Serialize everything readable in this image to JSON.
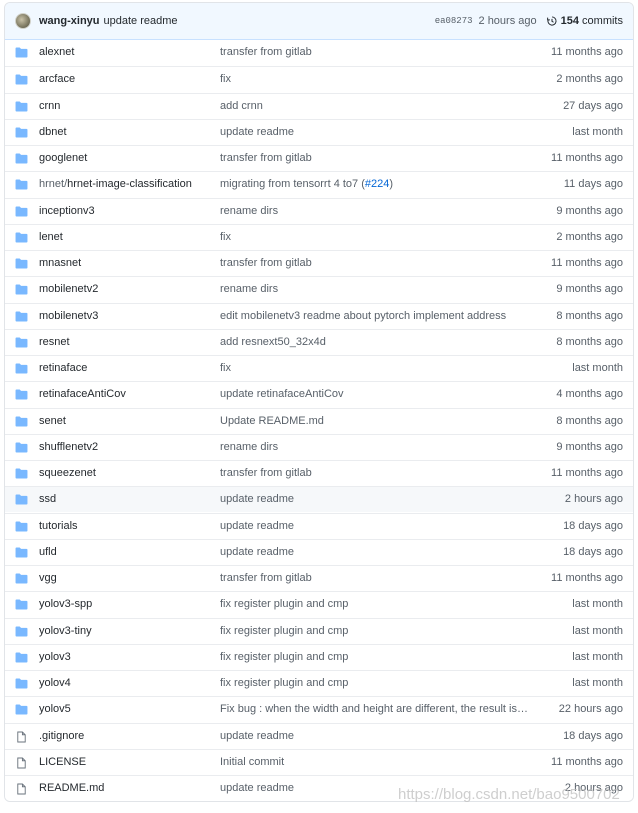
{
  "colors": {
    "folder": "#79b8ff",
    "link": "#0366d6",
    "header_bg": "#f1f8ff",
    "muted": "#586069"
  },
  "header": {
    "author": "wang-xinyu",
    "message": "update readme",
    "sha": "ea08273",
    "time": "2 hours ago",
    "commit_count": "154",
    "commits_label": "commits",
    "history_icon": "history-icon"
  },
  "files": [
    {
      "icon": "folder",
      "name": "alexnet",
      "message": "transfer from gitlab",
      "age": "11 months ago"
    },
    {
      "icon": "folder",
      "name": "arcface",
      "message": "fix",
      "age": "2 months ago"
    },
    {
      "icon": "folder",
      "name": "crnn",
      "message": "add crnn",
      "age": "27 days ago"
    },
    {
      "icon": "folder",
      "name": "dbnet",
      "message": "update readme",
      "age": "last month"
    },
    {
      "icon": "folder",
      "name": "googlenet",
      "message": "transfer from gitlab",
      "age": "11 months ago"
    },
    {
      "icon": "folder",
      "name_prefix": "hrnet/",
      "name": "hrnet-image-classification",
      "message": "migrating from tensorrt 4 to7 (",
      "message_link": "#224",
      "message_suffix": ")",
      "age": "11 days ago"
    },
    {
      "icon": "folder",
      "name": "inceptionv3",
      "message": "rename dirs",
      "age": "9 months ago"
    },
    {
      "icon": "folder",
      "name": "lenet",
      "message": "fix",
      "age": "2 months ago"
    },
    {
      "icon": "folder",
      "name": "mnasnet",
      "message": "transfer from gitlab",
      "age": "11 months ago"
    },
    {
      "icon": "folder",
      "name": "mobilenetv2",
      "message": "rename dirs",
      "age": "9 months ago"
    },
    {
      "icon": "folder",
      "name": "mobilenetv3",
      "message": "edit mobilenetv3 readme about pytorch implement address",
      "age": "8 months ago"
    },
    {
      "icon": "folder",
      "name": "resnet",
      "message": "add resnext50_32x4d",
      "age": "8 months ago"
    },
    {
      "icon": "folder",
      "name": "retinaface",
      "message": "fix",
      "age": "last month"
    },
    {
      "icon": "folder",
      "name": "retinafaceAntiCov",
      "message": "update retinafaceAntiCov",
      "age": "4 months ago"
    },
    {
      "icon": "folder",
      "name": "senet",
      "message": "Update README.md",
      "age": "8 months ago"
    },
    {
      "icon": "folder",
      "name": "shufflenetv2",
      "message": "rename dirs",
      "age": "9 months ago"
    },
    {
      "icon": "folder",
      "name": "squeezenet",
      "message": "transfer from gitlab",
      "age": "11 months ago"
    },
    {
      "icon": "folder",
      "name": "ssd",
      "message": "update readme",
      "age": "2 hours ago",
      "highlight": true
    },
    {
      "icon": "folder",
      "name": "tutorials",
      "message": "update readme",
      "age": "18 days ago"
    },
    {
      "icon": "folder",
      "name": "ufld",
      "message": "update readme",
      "age": "18 days ago"
    },
    {
      "icon": "folder",
      "name": "vgg",
      "message": "transfer from gitlab",
      "age": "11 months ago"
    },
    {
      "icon": "folder",
      "name": "yolov3-spp",
      "message": "fix register plugin and cmp",
      "age": "last month"
    },
    {
      "icon": "folder",
      "name": "yolov3-tiny",
      "message": "fix register plugin and cmp",
      "age": "last month"
    },
    {
      "icon": "folder",
      "name": "yolov3",
      "message": "fix register plugin and cmp",
      "age": "last month"
    },
    {
      "icon": "folder",
      "name": "yolov4",
      "message": "fix register plugin and cmp",
      "age": "last month"
    },
    {
      "icon": "folder",
      "name": "yolov5",
      "message": "Fix bug : when the width and height are different, the result is inco…",
      "age": "22 hours ago"
    },
    {
      "icon": "file",
      "name": ".gitignore",
      "message": "update readme",
      "age": "18 days ago"
    },
    {
      "icon": "file",
      "name": "LICENSE",
      "message": "Initial commit",
      "age": "11 months ago"
    },
    {
      "icon": "file",
      "name": "README.md",
      "message": "update readme",
      "age": "2 hours ago"
    }
  ],
  "watermark": "https://blog.csdn.net/bao9500702"
}
